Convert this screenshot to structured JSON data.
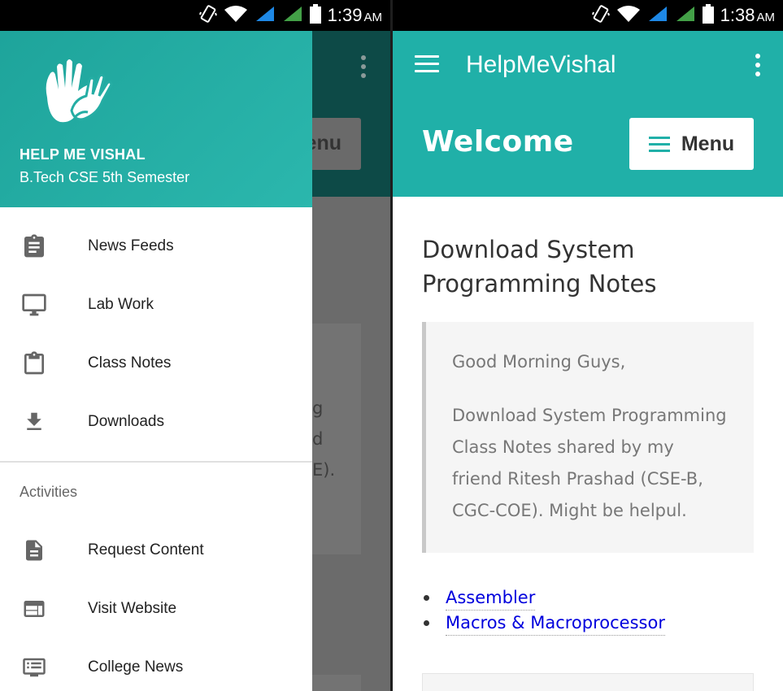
{
  "left": {
    "status": {
      "time": "1:39",
      "ampm": "AM"
    },
    "background": {
      "menu_label": "enu",
      "text_lines": [
        "g",
        "d",
        "E)."
      ]
    },
    "drawer": {
      "name": "HELP ME VISHAL",
      "subtitle": "B.Tech CSE 5th Semester",
      "items": [
        {
          "label": "News Feeds",
          "icon": "clipboard-text-icon"
        },
        {
          "label": "Lab Work",
          "icon": "monitor-icon"
        },
        {
          "label": "Class Notes",
          "icon": "clipboard-icon"
        },
        {
          "label": "Downloads",
          "icon": "download-icon"
        }
      ],
      "section_label": "Activities",
      "activity_items": [
        {
          "label": "Request Content",
          "icon": "document-icon"
        },
        {
          "label": "Visit Website",
          "icon": "web-icon"
        },
        {
          "label": "College News",
          "icon": "message-icon"
        }
      ]
    }
  },
  "right": {
    "status": {
      "time": "1:38",
      "ampm": "AM"
    },
    "app_title": "HelpMeVishal",
    "hero": {
      "title": "Welcome",
      "menu_label": "Menu"
    },
    "post": {
      "title": "Download System Programming Notes",
      "greeting": "Good Morning Guys,",
      "body": "Download System Programming Class Notes shared by my friend Ritesh Prashad (CSE-B, CGC-COE). Might be helpul.",
      "links": [
        "Assembler",
        "Macros & Macroprocessor"
      ]
    }
  },
  "colors": {
    "teal": "#20b0a8",
    "link": "#0000dd"
  }
}
